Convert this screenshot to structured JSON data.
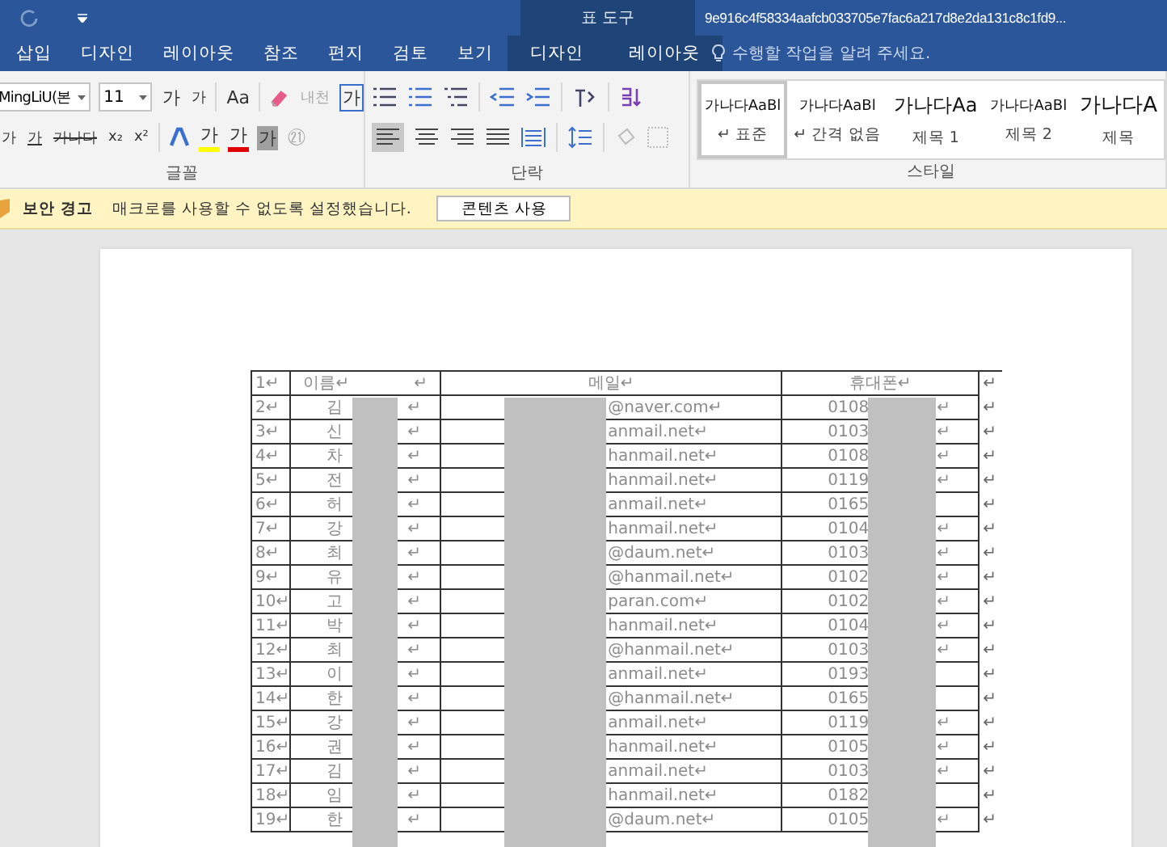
{
  "title_bar": {
    "context_title": "표 도구",
    "document_title": "9e916c4f58334aafcb033705e7fac6a217d8e2da131c8c1fd9...",
    "tell_me": "수행할 작업을 알려 주세요."
  },
  "tabs": [
    {
      "label": "삽입",
      "contextual": false
    },
    {
      "label": "디자인",
      "contextual": false
    },
    {
      "label": "레이아웃",
      "contextual": false
    },
    {
      "label": "참조",
      "contextual": false
    },
    {
      "label": "편지",
      "contextual": false
    },
    {
      "label": "검토",
      "contextual": false
    },
    {
      "label": "보기",
      "contextual": false
    },
    {
      "label": "디자인",
      "contextual": true
    },
    {
      "label": "레이아웃",
      "contextual": true
    }
  ],
  "font_group": {
    "label": "글꼴",
    "font_name": "MingLiU(본",
    "font_size": "11",
    "grow": "가",
    "shrink": "가",
    "change_case": "Aa",
    "phonetic": "내천",
    "char_border": "가",
    "italic": "가",
    "underline": "가",
    "strike": "가나다",
    "subscript": "x₂",
    "superscript": "x²",
    "highlight": "가",
    "font_color": "가",
    "shading": "가",
    "enclose": "㉑"
  },
  "paragraph_group": {
    "label": "단락"
  },
  "styles_group": {
    "label": "스타일",
    "styles": [
      {
        "preview": "가나다AaBl",
        "name": "↵ 표준",
        "selected": true
      },
      {
        "preview": "가나다AaBl",
        "name": "↵ 간격 없음",
        "selected": false
      },
      {
        "preview": "가나다Aa",
        "name": "제목 1",
        "selected": false
      },
      {
        "preview": "가나다AaBl",
        "name": "제목 2",
        "selected": false
      },
      {
        "preview": "가나다A",
        "name": "제목",
        "selected": false
      }
    ]
  },
  "message_bar": {
    "title": "보안 경고",
    "message": "매크로를 사용할 수 없도록 설정했습니다.",
    "button": "콘텐츠 사용"
  },
  "table": {
    "header": {
      "num": "1↵",
      "name": "이름↵",
      "name_tail": "↵",
      "email": "메일↵",
      "phone": "휴대폰↵",
      "end": "↵"
    },
    "rows": [
      {
        "num": "2↵",
        "name": "김",
        "name_tail": "↵",
        "email": "@naver.com↵",
        "phone": "0108",
        "phone_tail": "↵",
        "end": "↵"
      },
      {
        "num": "3↵",
        "name": "신",
        "name_tail": "↵",
        "email": "anmail.net↵",
        "phone": "0103",
        "phone_tail": "↵",
        "end": "↵"
      },
      {
        "num": "4↵",
        "name": "차",
        "name_tail": "↵",
        "email": "hanmail.net↵",
        "phone": "0108",
        "phone_tail": "↵",
        "end": "↵"
      },
      {
        "num": "5↵",
        "name": "전",
        "name_tail": "↵",
        "email": "hanmail.net↵",
        "phone": "0119",
        "phone_tail": "↵",
        "end": "↵"
      },
      {
        "num": "6↵",
        "name": "허",
        "name_tail": "↵",
        "email": "anmail.net↵",
        "phone": "0165",
        "end": "↵"
      },
      {
        "num": "7↵",
        "name": "강",
        "name_tail": "↵",
        "email": "hanmail.net↵",
        "phone": "0104",
        "phone_tail": "↵",
        "end": "↵"
      },
      {
        "num": "8↵",
        "name": "최",
        "name_tail": "↵",
        "email": "@daum.net↵",
        "phone": "0103",
        "phone_tail": "↵",
        "end": "↵"
      },
      {
        "num": "9↵",
        "name": "유",
        "name_tail": "↵",
        "email": "@hanmail.net↵",
        "phone": "0102",
        "phone_tail": "↵",
        "end": "↵"
      },
      {
        "num": "10↵",
        "name": "고",
        "name_tail": "↵",
        "email": "paran.com↵",
        "phone": "0102",
        "phone_tail": "↵",
        "end": "↵"
      },
      {
        "num": "11↵",
        "name": "박",
        "name_tail": "↵",
        "email": "hanmail.net↵",
        "phone": "0104",
        "phone_tail": "↵",
        "end": "↵"
      },
      {
        "num": "12↵",
        "name": "최",
        "name_tail": "↵",
        "email": "@hanmail.net↵",
        "phone": "0103",
        "phone_tail": "↵",
        "end": "↵"
      },
      {
        "num": "13↵",
        "name": "이",
        "name_tail": "↵",
        "email": "anmail.net↵",
        "phone": "0193",
        "end": "↵"
      },
      {
        "num": "14↵",
        "name": "한",
        "name_tail": "↵",
        "email": "@hanmail.net↵",
        "phone": "0165",
        "end": "↵"
      },
      {
        "num": "15↵",
        "name": "강",
        "name_tail": "↵",
        "email": "anmail.net↵",
        "phone": "0119",
        "phone_tail": "↵",
        "end": "↵"
      },
      {
        "num": "16↵",
        "name": "권",
        "name_tail": "↵",
        "email": "hanmail.net↵",
        "phone": "0105",
        "phone_tail": "↵",
        "end": "↵"
      },
      {
        "num": "17↵",
        "name": "김",
        "name_tail": "↵",
        "email": "anmail.net↵",
        "phone": "0103",
        "phone_tail": "↵",
        "end": "↵"
      },
      {
        "num": "18↵",
        "name": "임",
        "name_tail": "↵",
        "email": "hanmail.net↵",
        "phone": "0182",
        "end": "↵"
      },
      {
        "num": "19↵",
        "name": "한",
        "name_tail": "↵",
        "email": "@daum.net↵",
        "phone": "0105",
        "phone_tail": "↵",
        "end": "↵"
      }
    ]
  }
}
